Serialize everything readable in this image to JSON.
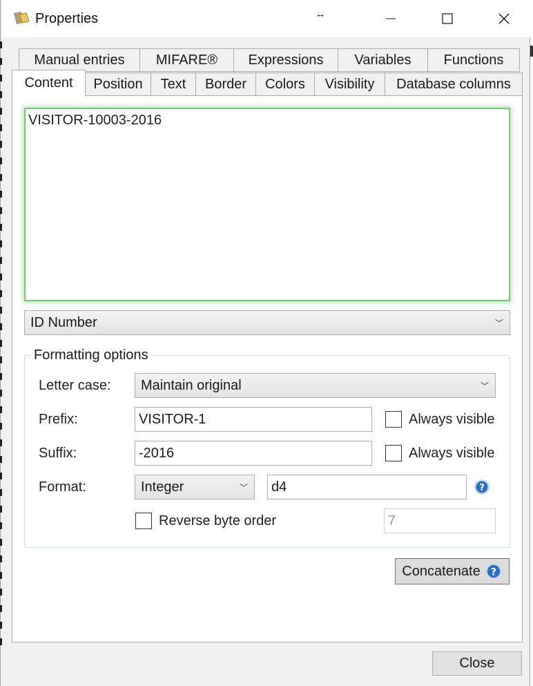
{
  "window": {
    "title": "Properties",
    "resize_glyph": "↔"
  },
  "tabs_row1": [
    {
      "label": "Manual entries"
    },
    {
      "label": "MIFARE®"
    },
    {
      "label": "Expressions"
    },
    {
      "label": "Variables"
    },
    {
      "label": "Functions"
    }
  ],
  "tabs_row2": [
    {
      "label": "Content",
      "active": true
    },
    {
      "label": "Position"
    },
    {
      "label": "Text"
    },
    {
      "label": "Border"
    },
    {
      "label": "Colors"
    },
    {
      "label": "Visibility"
    },
    {
      "label": "Database columns"
    }
  ],
  "content": {
    "preview_text": "VISITOR-10003-2016",
    "source_field": "ID Number"
  },
  "formatting": {
    "legend": "Formatting options",
    "letter_case_label": "Letter case:",
    "letter_case_value": "Maintain original",
    "prefix_label": "Prefix:",
    "prefix_value": "VISITOR-1",
    "prefix_always_visible": "Always visible",
    "suffix_label": "Suffix:",
    "suffix_value": "-2016",
    "suffix_always_visible": "Always visible",
    "format_label": "Format:",
    "format_type": "Integer",
    "format_string": "d4",
    "reverse_byte_order": "Reverse byte order",
    "byte_count": "7"
  },
  "buttons": {
    "concatenate": "Concatenate",
    "close": "Close"
  },
  "icons": {
    "help": "help-icon",
    "app": "app-icon"
  },
  "colors": {
    "focus_glow": "#7ac77a",
    "help_blue": "#2d6fc0"
  }
}
